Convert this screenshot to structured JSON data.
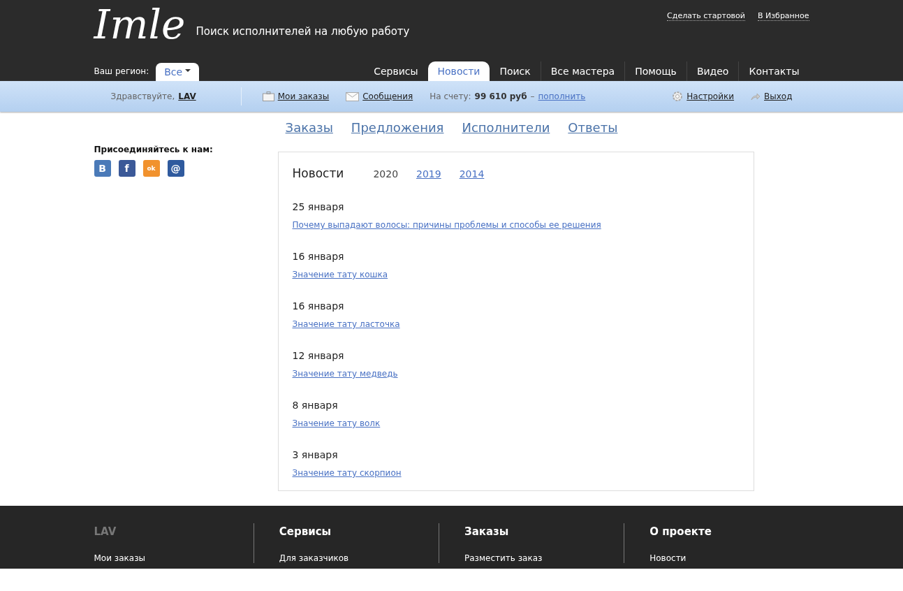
{
  "header": {
    "logo": "Imle",
    "tagline": "Поиск исполнителей на любую работу",
    "top_links": [
      "Сделать стартовой",
      "В Избранное"
    ],
    "region_label": "Ваш регион:",
    "region_value": "Все",
    "nav": [
      {
        "label": "Сервисы",
        "selected": false
      },
      {
        "label": "Новости",
        "selected": true
      },
      {
        "label": "Поиск",
        "selected": false
      },
      {
        "label": "Все мастера",
        "selected": false
      },
      {
        "label": "Помощь",
        "selected": false
      },
      {
        "label": "Видео",
        "selected": false
      },
      {
        "label": "Контакты",
        "selected": false
      }
    ]
  },
  "user_bar": {
    "greeting": "Здравствуйте,",
    "user": "LAV",
    "my_orders": "Мои заказы",
    "messages": "Сообщения",
    "balance_label": "На счету:",
    "balance": "99 610 руб",
    "dash": "–",
    "top_up": "пополнить",
    "settings": "Настройки",
    "logout": "Выход"
  },
  "subnav": [
    "Заказы",
    "Предложения",
    "Исполнители",
    "Ответы"
  ],
  "sidebar": {
    "join_title": "Присоединяйтесь к нам:",
    "socials": [
      {
        "kind": "vk",
        "label": "В"
      },
      {
        "kind": "fb",
        "label": "f"
      },
      {
        "kind": "ok",
        "label": "ok"
      },
      {
        "kind": "mail",
        "label": "@"
      }
    ]
  },
  "news": {
    "title": "Новости",
    "years": [
      {
        "label": "2020",
        "selected": true
      },
      {
        "label": "2019",
        "selected": false
      },
      {
        "label": "2014",
        "selected": false
      }
    ],
    "items": [
      {
        "date": "25 января",
        "title": "Почему выпадают волосы: причины проблемы и способы ее решения"
      },
      {
        "date": "16 января",
        "title": "Значение тату кошка"
      },
      {
        "date": "16 января",
        "title": "Значение тату ласточка"
      },
      {
        "date": "12 января",
        "title": "Значение тату медведь"
      },
      {
        "date": "8 января",
        "title": "Значение тату волк"
      },
      {
        "date": "3 января",
        "title": "Значение тату скорпион"
      }
    ]
  },
  "footer": {
    "columns": [
      {
        "title": "LAV",
        "muted": true,
        "links": [
          "Мои заказы"
        ]
      },
      {
        "title": "Сервисы",
        "muted": false,
        "links": [
          "Для заказчиков"
        ]
      },
      {
        "title": "Заказы",
        "muted": false,
        "links": [
          "Разместить заказ"
        ]
      },
      {
        "title": "О проекте",
        "muted": false,
        "links": [
          "Новости"
        ]
      }
    ]
  }
}
